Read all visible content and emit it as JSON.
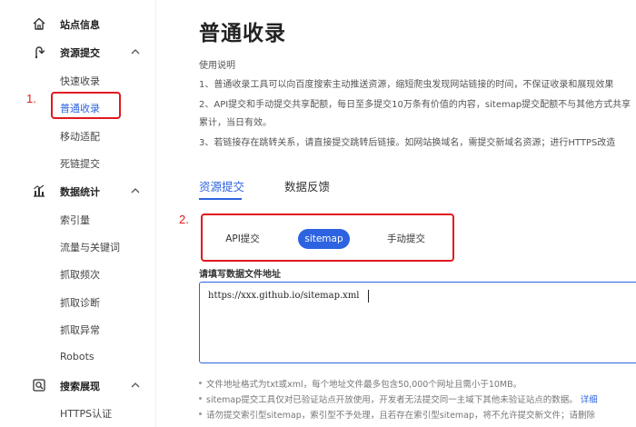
{
  "sidebar": {
    "groups": [
      {
        "label": "站点信息",
        "icon": "home-icon"
      },
      {
        "label": "资源提交",
        "icon": "submit-icon",
        "items": [
          "快速收录",
          "普通收录",
          "移动适配",
          "死链提交"
        ]
      },
      {
        "label": "数据统计",
        "icon": "chart-icon",
        "items": [
          "索引量",
          "流量与关键词",
          "抓取频次",
          "抓取诊断",
          "抓取异常",
          "Robots"
        ]
      },
      {
        "label": "搜索展现",
        "icon": "search-display-icon",
        "items": [
          "HTTPS认证"
        ]
      }
    ]
  },
  "main": {
    "title": "普通收录",
    "usage_heading": "使用说明",
    "usage_lines": [
      "1、普通收录工具可以向百度搜索主动推送资源，缩短爬虫发现网站链接的时间，不保证收录和展现效果",
      "2、API提交和手动提交共享配额，每日至多提交10万条有价值的内容，sitemap提交配额不与其他方式共享",
      "累计，当日有效。",
      "3、若链接存在跳转关系，请直接提交跳转后链接。如网站换域名，需提交新域名资源；进行HTTPS改造"
    ],
    "tabs": [
      {
        "label": "资源提交",
        "active": true
      },
      {
        "label": "数据反馈",
        "active": false
      }
    ],
    "methods": [
      {
        "label": "API提交",
        "active": false
      },
      {
        "label": "sitemap",
        "active": true
      },
      {
        "label": "手动提交",
        "active": false
      }
    ],
    "field_label": "请填写数据文件地址",
    "sitemap_value": "https://xxx.github.io/sitemap.xml",
    "notes": [
      {
        "text": "文件地址格式为txt或xml，每个地址文件最多包含50,000个网址且需小于10MB。",
        "link": ""
      },
      {
        "text": "sitemap提交工具仅对已验证站点开放使用，开发者无法提交同一主域下其他未验证站点的数据。",
        "link": "详细"
      },
      {
        "text": "请勿提交索引型sitemap，索引型不予处理，且若存在索引型sitemap，将不允许提交新文件；请删除",
        "link": ""
      }
    ]
  },
  "annotations": {
    "first": "1.",
    "second": "2."
  },
  "colors": {
    "accent": "#2d63e0",
    "annotation": "#e0191f"
  }
}
